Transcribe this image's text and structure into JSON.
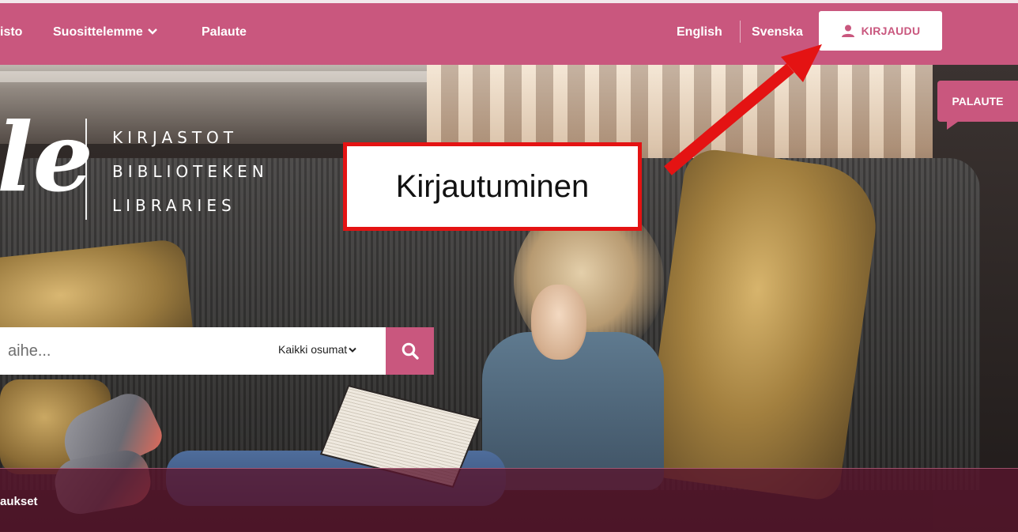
{
  "nav": {
    "items": [
      {
        "label": "isto"
      },
      {
        "label": "Suosittelemme"
      },
      {
        "label": "Palaute"
      }
    ],
    "chevron_icon": "chevron-down-icon",
    "languages": [
      {
        "label": "English"
      },
      {
        "label": "Svenska"
      }
    ],
    "login": {
      "label": "KIRJAUDU",
      "icon": "user-icon"
    }
  },
  "logo": {
    "script": "le",
    "lines": [
      "KIRJASTOT",
      "BIBLIOTEKEN",
      "LIBRARIES"
    ]
  },
  "feedback_tab": {
    "label": "PALAUTE"
  },
  "annotation": {
    "label": "Kirjautuminen",
    "color": "#e41313"
  },
  "search": {
    "placeholder": "aihe...",
    "scope_label": "Kaikki osumat",
    "button_icon": "search-icon"
  },
  "bottom": {
    "label": "aukset"
  },
  "colors": {
    "brand": "#c9577e",
    "band": "#5a142d"
  }
}
